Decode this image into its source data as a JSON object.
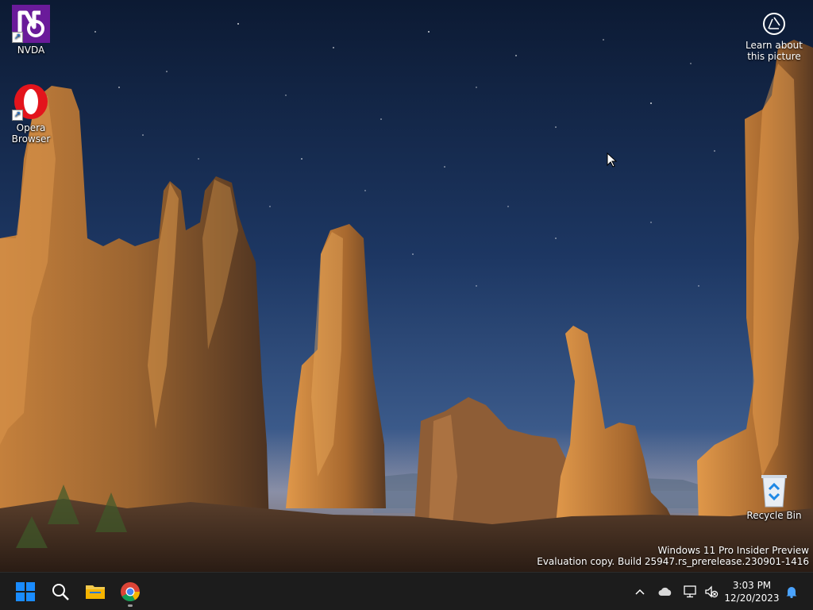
{
  "desktop": {
    "icons": [
      {
        "label": "NVDA",
        "icon": "nvda-icon"
      },
      {
        "label": "Opera Browser",
        "icon": "opera-icon"
      },
      {
        "label": "Recycle Bin",
        "icon": "recycle-bin-icon"
      }
    ],
    "learn_about_picture": {
      "label": "Learn about this picture",
      "icon": "camera-lens-icon"
    },
    "watermark": {
      "line1": "Windows 11 Pro Insider Preview",
      "line2": "Evaluation copy. Build 25947.rs_prerelease.230901-1416"
    }
  },
  "taskbar": {
    "pinned": [
      {
        "name": "Start",
        "icon": "windows-start-icon"
      },
      {
        "name": "Search",
        "icon": "search-icon"
      },
      {
        "name": "File Explorer",
        "icon": "folder-icon"
      },
      {
        "name": "Google Chrome",
        "icon": "chrome-icon"
      }
    ],
    "tray": {
      "icons": [
        "chevron-up-icon",
        "onedrive-cloud-icon",
        "network-icon",
        "volume-muted-icon",
        "notification-bell-icon"
      ]
    },
    "clock": {
      "time": "3:03 PM",
      "date": "12/20/2023"
    }
  },
  "colors": {
    "taskbar_bg": "#1c1c1c",
    "windows_blue": "#1a8cff",
    "nvda_purple": "#6a1b9a",
    "opera_red": "#e3141c",
    "folder_yellow": "#f2c94c"
  }
}
